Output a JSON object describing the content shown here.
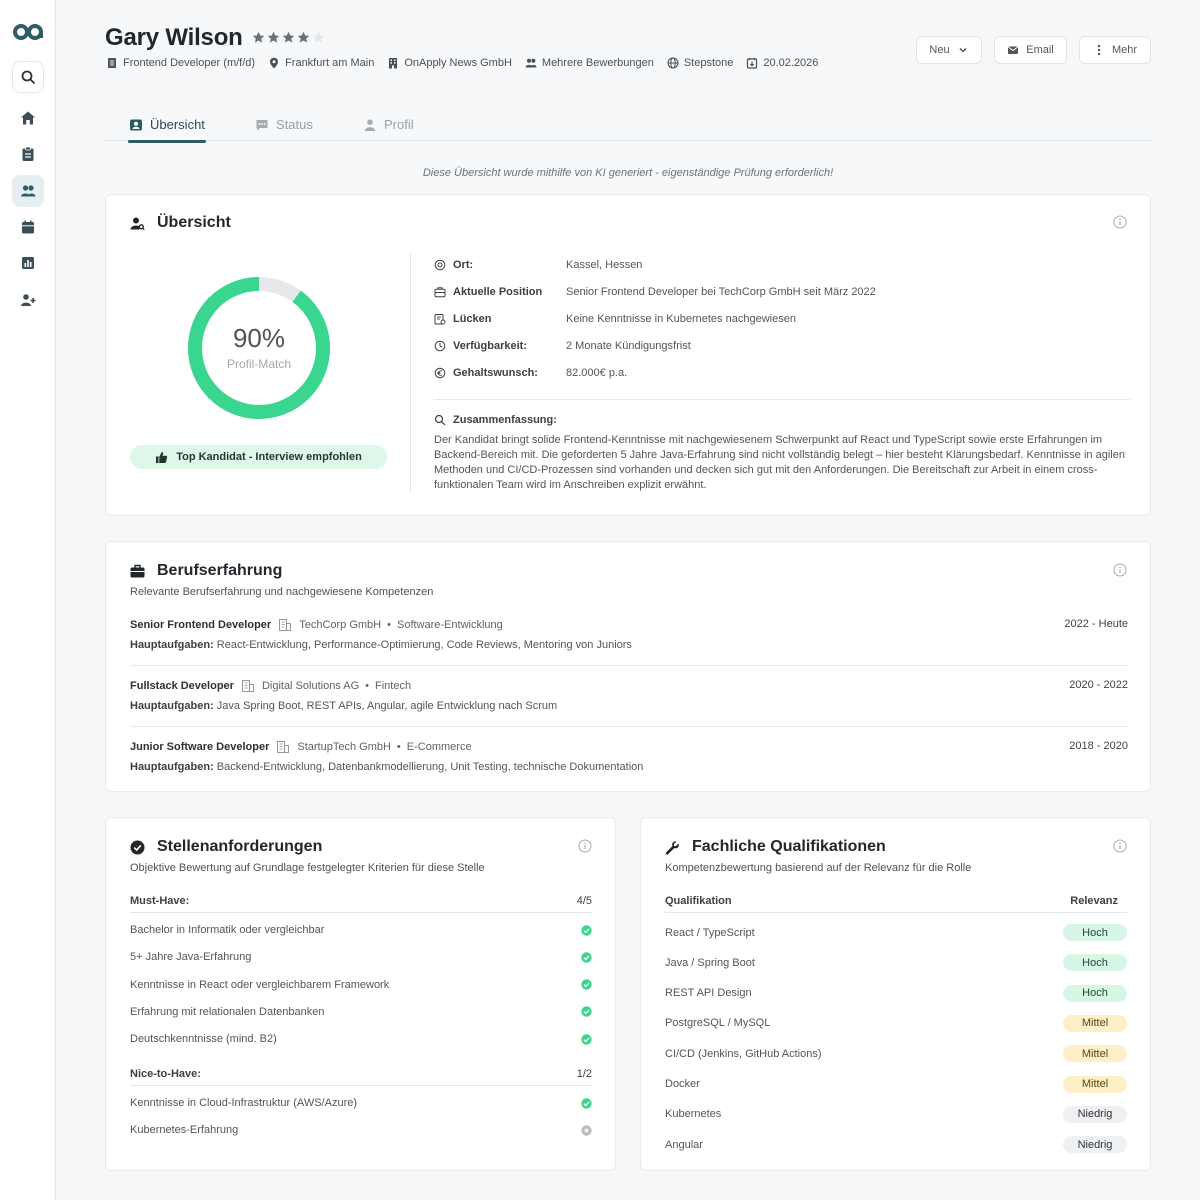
{
  "colors": {
    "accent": "#2e5c66",
    "success": "#3ad58e",
    "track": "#e6e8eb",
    "high": "#d8f6e6",
    "medium": "#fdf0c8",
    "low": "#eef0f2"
  },
  "sidebar": {
    "items": [
      {
        "icon": "search-icon"
      },
      {
        "icon": "home-icon"
      },
      {
        "icon": "clipboard-icon"
      },
      {
        "icon": "users-icon",
        "active": true
      },
      {
        "icon": "calendar-icon"
      },
      {
        "icon": "chart-icon"
      },
      {
        "icon": "add-user-icon"
      }
    ]
  },
  "header": {
    "name": "Gary Wilson",
    "rating": 4,
    "rating_max": 5,
    "meta": {
      "position": "Frontend Developer (m/f/d)",
      "location": "Frankfurt am Main",
      "company": "OnApply News GmbH",
      "applications": "Mehrere Bewerbungen",
      "source": "Stepstone",
      "date": "20.02.2026"
    },
    "buttons": {
      "status": "Neu",
      "email": "Email",
      "more": "Mehr"
    }
  },
  "tabs": [
    {
      "label": "Übersicht",
      "active": true
    },
    {
      "label": "Status"
    },
    {
      "label": "Profil"
    }
  ],
  "ai_note": "Diese Übersicht wurde mithilfe von KI generiert - eigenständige Prüfung erforderlich!",
  "overview": {
    "title": "Übersicht",
    "match_percent": 90,
    "match_text": "90%",
    "match_label": "Profil-Match",
    "badge": "Top Kandidat - Interview empfohlen",
    "details": [
      {
        "key": "Ort:",
        "value": "Kassel, Hessen",
        "icon": "location-icon"
      },
      {
        "key": "Aktuelle Position",
        "value": "Senior Frontend Developer bei TechCorp GmbH seit März 2022",
        "icon": "briefcase-icon"
      },
      {
        "key": "Lücken",
        "value": "Keine Kenntnisse in Kubernetes nachgewiesen",
        "icon": "gap-icon"
      },
      {
        "key": "Verfügbarkeit:",
        "value": "2 Monate Kündigungsfrist",
        "icon": "availability-icon"
      },
      {
        "key": "Gehaltswunsch:",
        "value": "82.000€ p.a.",
        "icon": "euro-icon"
      }
    ],
    "summary_title": "Zusammenfassung:",
    "summary": "Der Kandidat bringt solide Frontend-Kenntnisse mit nachgewiesenem Schwerpunkt auf React und TypeScript sowie erste Erfahrungen im Backend-Bereich mit. Die geforderten 5 Jahre Java-Erfahrung sind nicht vollständig belegt – hier besteht Klärungsbedarf. Kenntnisse in agilen Methoden und CI/CD-Prozessen sind vorhanden und decken sich gut mit den Anforderungen. Die Bereitschaft zur Arbeit in einem cross-funktionalen Team wird im Anschreiben explizit erwähnt."
  },
  "experience": {
    "title": "Berufserfahrung",
    "subtitle": "Relevante Berufserfahrung und nachgewiesene Kompetenzen",
    "tasks_label": "Hauptaufgaben:",
    "items": [
      {
        "title": "Senior Frontend Developer",
        "company": "TechCorp GmbH",
        "sector": "Software-Entwicklung",
        "period": "2022 - Heute",
        "tasks": "React-Entwicklung, Performance-Optimierung, Code Reviews, Mentoring von Juniors"
      },
      {
        "title": "Fullstack Developer",
        "company": "Digital Solutions AG",
        "sector": "Fintech",
        "period": "2020 - 2022",
        "tasks": "Java Spring Boot, REST APIs, Angular, agile Entwicklung nach Scrum"
      },
      {
        "title": "Junior Software Developer",
        "company": "StartupTech GmbH",
        "sector": "E-Commerce",
        "period": "2018 - 2020",
        "tasks": "Backend-Entwicklung, Datenbankmodellierung, Unit Testing, technische Dokumentation"
      }
    ]
  },
  "requirements": {
    "title": "Stellenanforderungen",
    "subtitle": "Objektive Bewertung auf Grundlage festgelegter Kriterien für diese Stelle",
    "must_label": "Must-Have:",
    "must_count": "4/5",
    "must": [
      {
        "text": "Bachelor in Informatik oder vergleichbar",
        "met": true
      },
      {
        "text": "5+ Jahre Java-Erfahrung",
        "met": true
      },
      {
        "text": "Kenntnisse in React oder vergleichbarem Framework",
        "met": true
      },
      {
        "text": "Erfahrung mit relationalen Datenbanken",
        "met": true
      },
      {
        "text": "Deutschkenntnisse (mind. B2)",
        "met": true
      }
    ],
    "nice_label": "Nice-to-Have:",
    "nice_count": "1/2",
    "nice": [
      {
        "text": "Kenntnisse in Cloud-Infrastruktur (AWS/Azure)",
        "met": true
      },
      {
        "text": "Kubernetes-Erfahrung",
        "met": false
      }
    ]
  },
  "qualifications": {
    "title": "Fachliche Qualifikationen",
    "subtitle": "Kompetenzbewertung basierend auf der Relevanz für die Rolle",
    "col_skill": "Qualifikation",
    "col_relevance": "Relevanz",
    "items": [
      {
        "skill": "React / TypeScript",
        "relevance": "Hoch",
        "level": "hoch"
      },
      {
        "skill": "Java / Spring Boot",
        "relevance": "Hoch",
        "level": "hoch"
      },
      {
        "skill": "REST API Design",
        "relevance": "Hoch",
        "level": "hoch"
      },
      {
        "skill": "PostgreSQL / MySQL",
        "relevance": "Mittel",
        "level": "mittel"
      },
      {
        "skill": "CI/CD (Jenkins, GitHub Actions)",
        "relevance": "Mittel",
        "level": "mittel"
      },
      {
        "skill": "Docker",
        "relevance": "Mittel",
        "level": "mittel"
      },
      {
        "skill": "Kubernetes",
        "relevance": "Niedrig",
        "level": "niedrig"
      },
      {
        "skill": "Angular",
        "relevance": "Niedrig",
        "level": "niedrig"
      }
    ]
  }
}
